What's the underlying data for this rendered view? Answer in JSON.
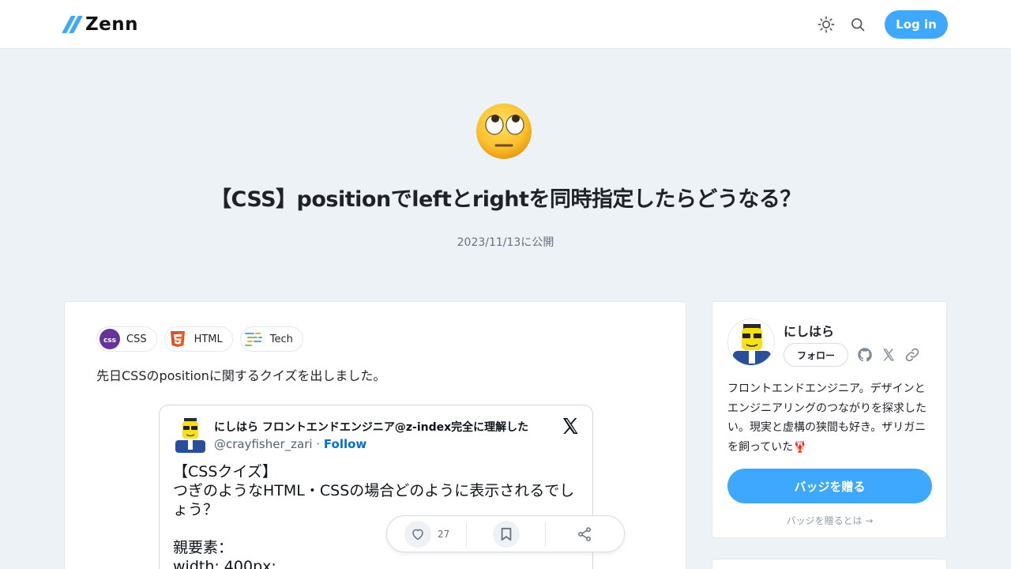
{
  "header": {
    "logo_text": "Zenn",
    "login_label": "Log in"
  },
  "article": {
    "title": "【CSS】positionでleftとrightを同時指定したらどうなる？",
    "date": "2023/11/13に公開",
    "lead": "先日CSSのpositionに関するクイズを出しました。",
    "topics": [
      {
        "label": "CSS",
        "icon": "css-icon"
      },
      {
        "label": "HTML",
        "icon": "html5-icon"
      },
      {
        "label": "Tech",
        "icon": "tech-icon"
      }
    ]
  },
  "tweet": {
    "name": "にしはら フロントエンドエンジニア@z-index完全に理解した",
    "handle": "@crayfisher_zari",
    "separator": " · ",
    "follow": "Follow",
    "body": "【CSSクイズ】\nつぎのようなHTML・CSSの場合どのように表示されるでしょう？\n\n親要素：\nwidth: 400px;"
  },
  "actions": {
    "like_count": "27"
  },
  "author": {
    "name": "にしはら",
    "follow_label": "フォロー",
    "bio": "フロントエンドエンジニア。デザインとエンジニアリングのつながりを探求したい。現実と虚構の狭間も好き。ザリガニを飼っていた🦞",
    "badge_button": "バッジを贈る",
    "badge_link": "バッジを贈るとは →"
  },
  "colors": {
    "accent": "#3ea8ff",
    "background": "#edf2f7"
  }
}
